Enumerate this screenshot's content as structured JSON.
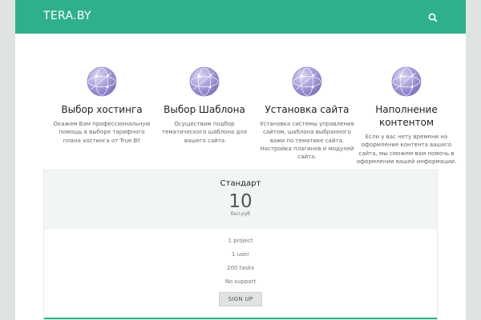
{
  "header": {
    "brand": "TERA.BY"
  },
  "features": [
    {
      "title": "Выбор хостинга",
      "text": "Окажем Вам профессиональную помощь в выборе тарифного плана хостинга от True.BY"
    },
    {
      "title": "Выбор Шаблона",
      "text": "Осуществим подбор тематического шаблона для вашего сайта"
    },
    {
      "title": "Установка сайта",
      "text": "Установка системы управления сайтом, шаблона выбранного вами по тематике сайта. Настройка плагинов и модулей сайта."
    },
    {
      "title": "Наполнение контентом",
      "text": "Если у вас нету времени на оформление контента вашего сайта, мы сможем вам помочь в оформлении вашей информации."
    }
  ],
  "plan": {
    "name": "Стандарт",
    "price": "10",
    "unit": "бел.руб",
    "items": [
      "1 project",
      "1 user",
      "200 tasks",
      "No support"
    ],
    "button": "SIGN UP"
  },
  "colors": {
    "accent": "#2fb08c",
    "background": "#dfe3e2"
  },
  "icons": {
    "header": "search-icon",
    "feature": "globe-icon"
  }
}
